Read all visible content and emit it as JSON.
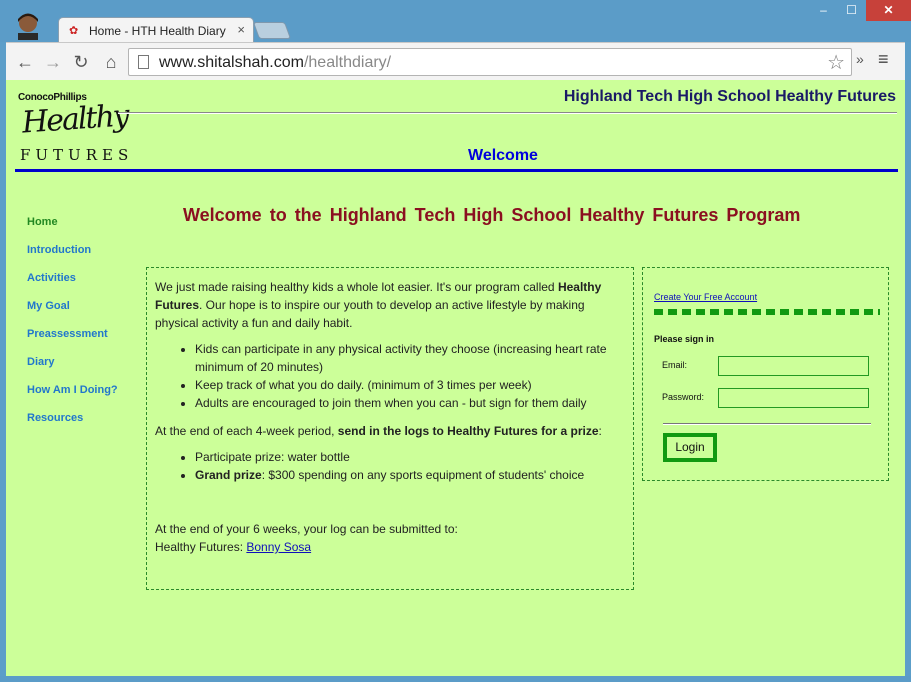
{
  "browser": {
    "tab_title": "Home - HTH Health Diary",
    "tab_close": "×",
    "url_domain": "www.shitalshah.com",
    "url_path": "/healthdiary/",
    "window_controls": {
      "minimize": "–",
      "maximize": "☐",
      "close": "✕"
    },
    "icons": {
      "back": "←",
      "forward": "→",
      "reload": "↻",
      "home": "⌂",
      "star": "☆",
      "extensions": "»",
      "menu": "≡"
    }
  },
  "header": {
    "logo": {
      "company": "ConocoPhillips",
      "healthy": "Healthy",
      "futures": "FUTURES"
    },
    "site_title": "Highland Tech High School Healthy Futures",
    "section_title": "Welcome"
  },
  "sidebar": {
    "items": [
      {
        "label": "Home",
        "active": true
      },
      {
        "label": "Introduction"
      },
      {
        "label": "Activities"
      },
      {
        "label": "My Goal"
      },
      {
        "label": "Preassessment"
      },
      {
        "label": "Diary"
      },
      {
        "label": "How Am I Doing?"
      },
      {
        "label": "Resources"
      }
    ]
  },
  "main": {
    "heading": "Welcome to the Highland Tech High School Healthy Futures Program",
    "intro_1": "We just made raising healthy kids a whole lot easier. It's our program called ",
    "intro_bold": "Healthy Futures",
    "intro_2": ". Our hope is to inspire our youth to develop an active lifestyle by making physical activity a fun and daily habit.",
    "bullets": [
      "Kids can participate in any physical activity they choose (increasing heart rate minimum of 20 minutes)",
      "Keep track of what you do daily. (minimum of 3 times per week)",
      "Adults are encouraged to join them when you can - but sign for them daily"
    ],
    "period_1": "At the end of each 4-week period, ",
    "period_bold": "send in the logs to Healthy Futures for a prize",
    "period_2": ":",
    "prizes": {
      "participate": "Participate prize: water bottle",
      "grand_label": "Grand prize",
      "grand_text": ": $300 spending on any sports equipment of students' choice"
    },
    "submit_text": "At the end of your 6 weeks, your log can be submitted to:",
    "contact_prefix": "Healthy Futures: ",
    "contact_link": "Bonny Sosa"
  },
  "login": {
    "create_account": "Create Your Free Account",
    "signin_label": "Please sign in",
    "email_label": "Email:",
    "email_value": "",
    "password_label": "Password:",
    "password_value": "",
    "login_button": "Login"
  }
}
